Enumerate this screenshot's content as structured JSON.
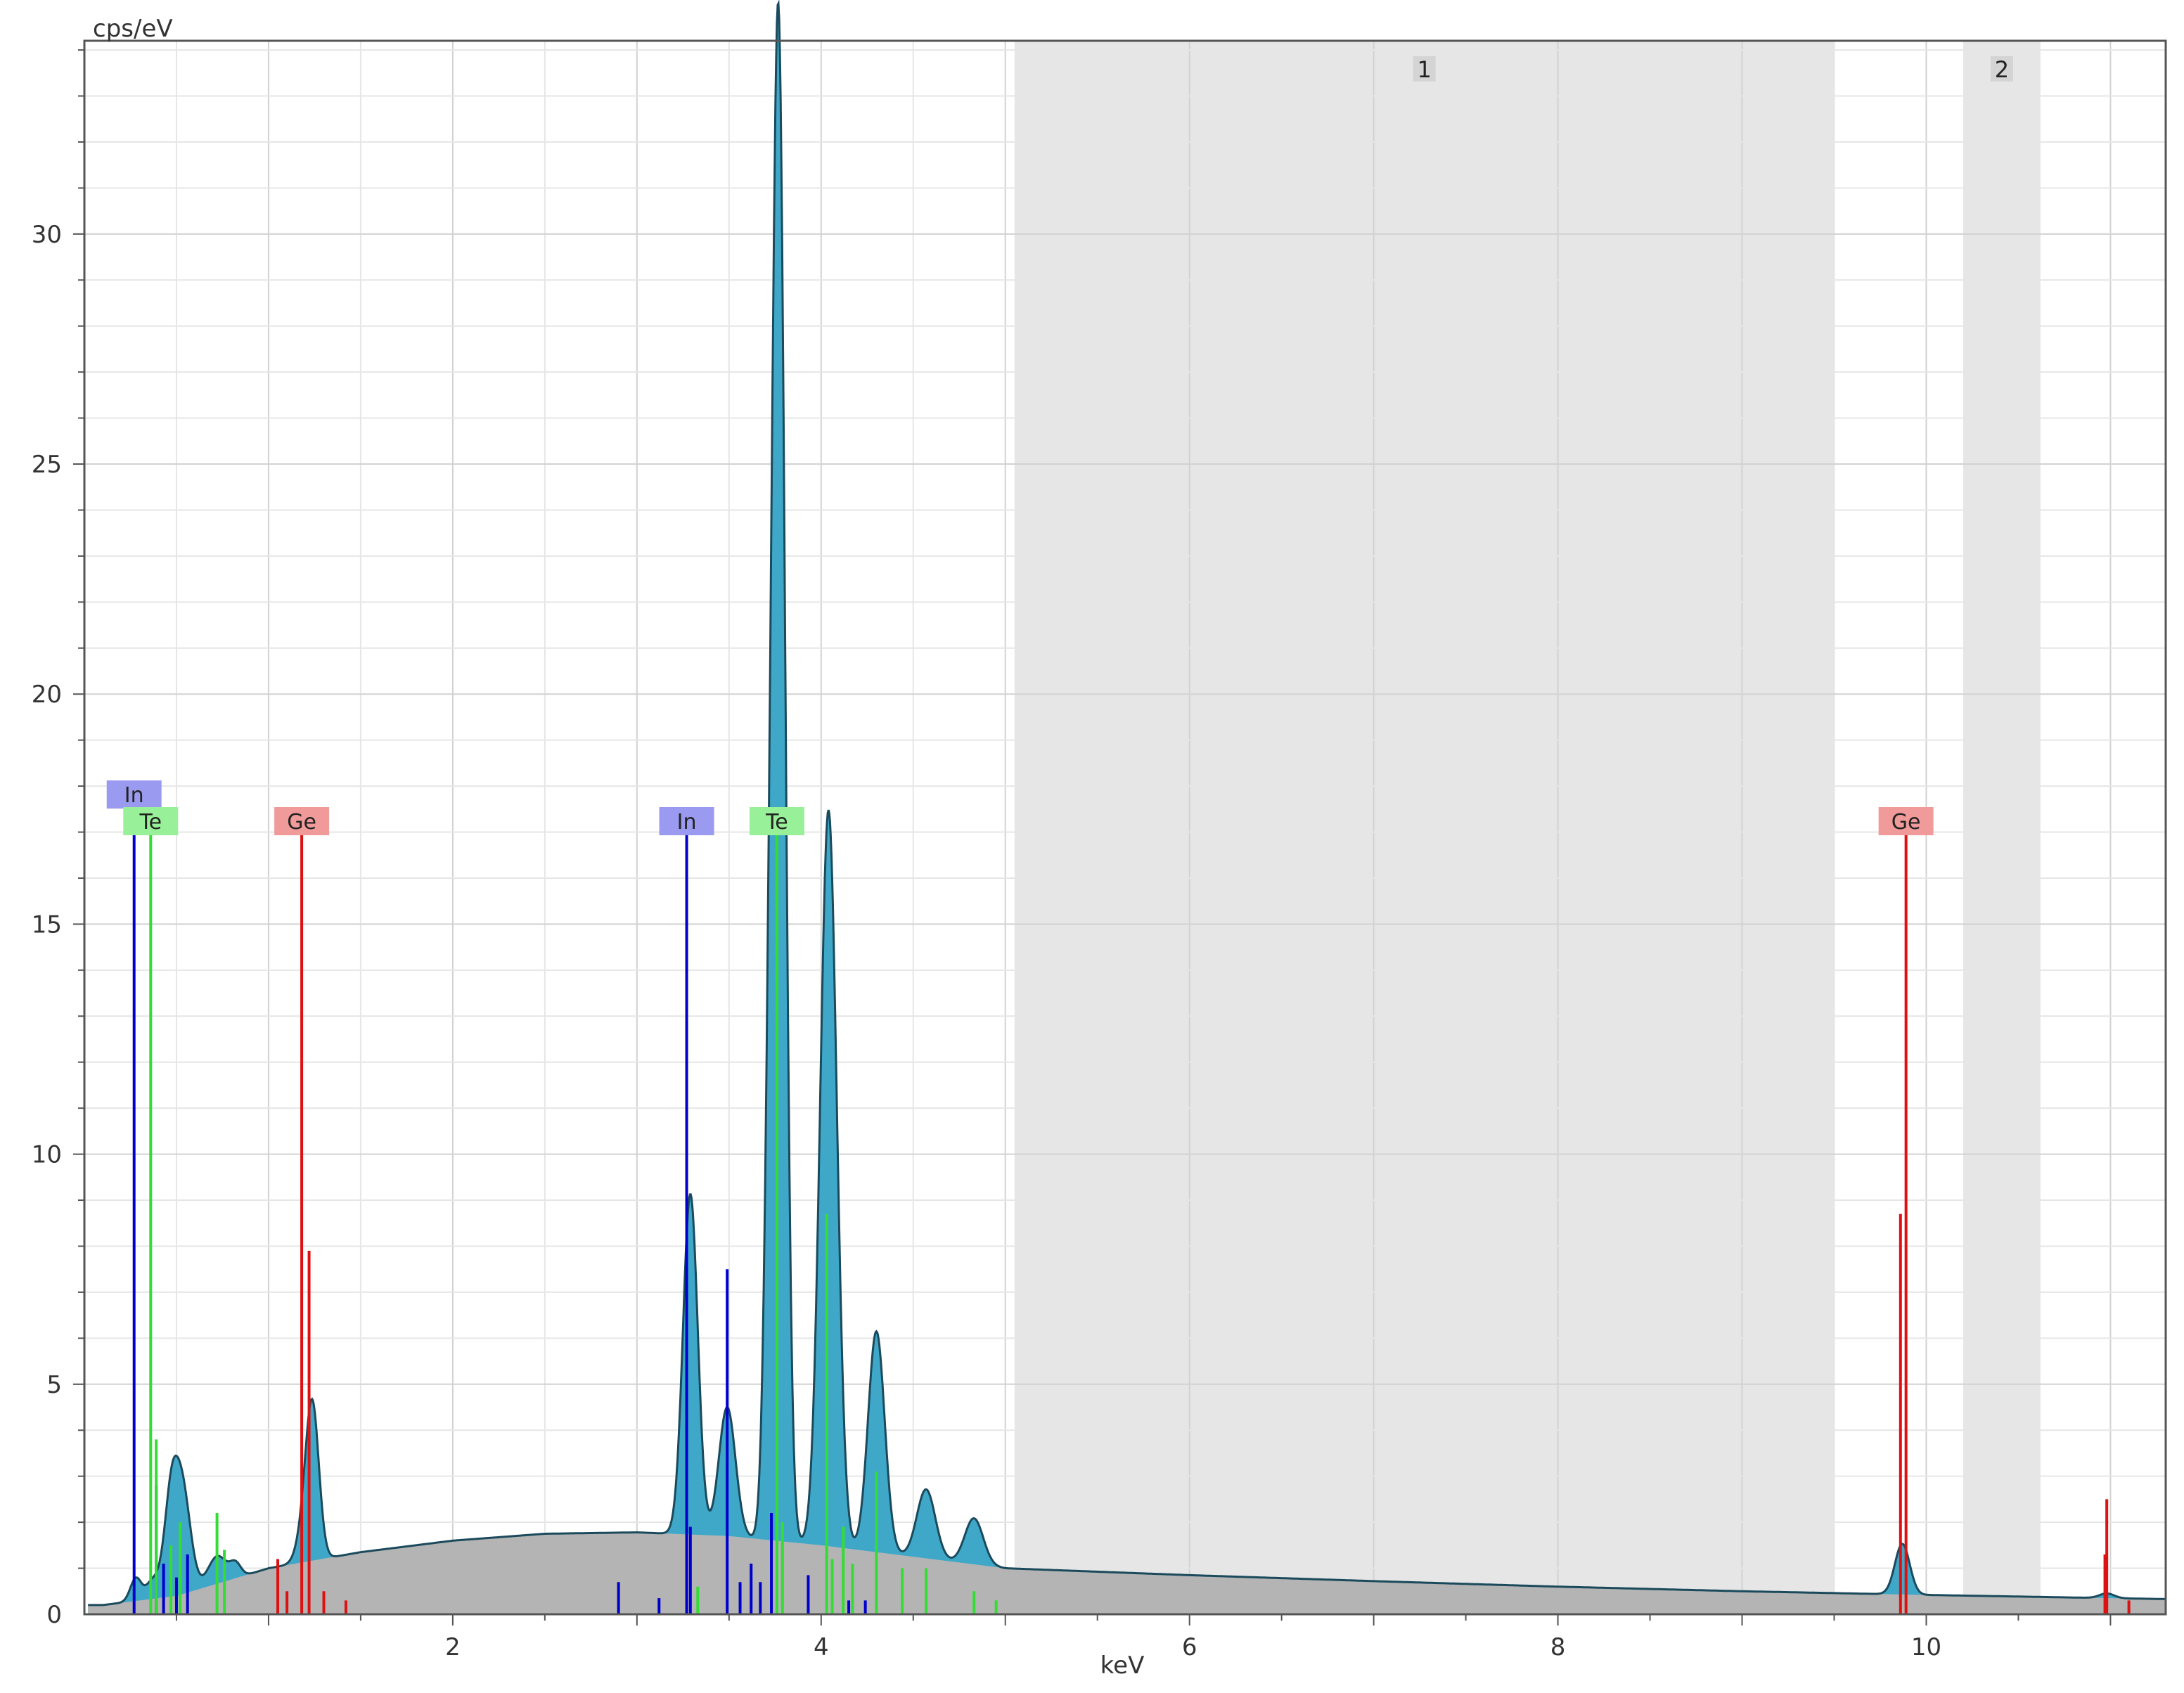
{
  "chart_data": {
    "type": "area",
    "ylabel": "cps/eV",
    "xlabel": "keV",
    "xlim": [
      0,
      11.3
    ],
    "ylim": [
      0,
      34.2
    ],
    "x_ticks": [
      2,
      4,
      6,
      8,
      10
    ],
    "x_tick_labels": [
      "2",
      "4",
      "6",
      "8",
      "10"
    ],
    "y_ticks": [
      5,
      10,
      15,
      20,
      25,
      30
    ],
    "y_tick_labels": [
      "5",
      "10",
      "15",
      "20",
      "25",
      "30"
    ],
    "grid": true,
    "regions": [
      {
        "label": "1",
        "x_range": [
          5.05,
          9.5
        ]
      },
      {
        "label": "2",
        "x_range": [
          10.2,
          10.62
        ]
      }
    ],
    "colors": {
      "spectrum_fill": "#3fa8c9",
      "spectrum_outline": "#1b4a5c",
      "background_fill": "#b4b4b4",
      "region_fill": "#e6e6e6",
      "In": "#0000cc",
      "Te": "#33dd33",
      "Ge": "#dd1111",
      "In_label_bg": "#9a9af0",
      "Te_label_bg": "#98f098",
      "Ge_label_bg": "#f09a9a"
    },
    "spectrum": {
      "background": [
        [
          0.1,
          0.2
        ],
        [
          0.5,
          0.4
        ],
        [
          1.0,
          1.0
        ],
        [
          1.5,
          1.35
        ],
        [
          2.0,
          1.6
        ],
        [
          2.5,
          1.75
        ],
        [
          3.0,
          1.78
        ],
        [
          3.5,
          1.7
        ],
        [
          4.0,
          1.5
        ],
        [
          4.5,
          1.25
        ],
        [
          5.0,
          1.0
        ],
        [
          6.0,
          0.85
        ],
        [
          7.0,
          0.72
        ],
        [
          8.0,
          0.6
        ],
        [
          9.0,
          0.5
        ],
        [
          10.0,
          0.42
        ],
        [
          11.0,
          0.35
        ],
        [
          11.3,
          0.33
        ]
      ],
      "peaks": [
        {
          "x": 0.28,
          "h": 0.5,
          "w": 0.03
        },
        {
          "x": 0.36,
          "h": 0.25,
          "w": 0.03
        },
        {
          "x": 0.41,
          "h": 0.3,
          "w": 0.04
        },
        {
          "x": 0.47,
          "h": 1.7,
          "w": 0.035
        },
        {
          "x": 0.53,
          "h": 2.3,
          "w": 0.045
        },
        {
          "x": 0.72,
          "h": 0.6,
          "w": 0.05
        },
        {
          "x": 0.82,
          "h": 0.3,
          "w": 0.03
        },
        {
          "x": 1.2,
          "h": 0.8,
          "w": 0.04
        },
        {
          "x": 1.24,
          "h": 3.0,
          "w": 0.035
        },
        {
          "x": 3.29,
          "h": 7.4,
          "w": 0.04
        },
        {
          "x": 3.49,
          "h": 2.8,
          "w": 0.045
        },
        {
          "x": 3.72,
          "h": 6.0,
          "w": 0.03
        },
        {
          "x": 3.77,
          "h": 31.8,
          "w": 0.035
        },
        {
          "x": 4.04,
          "h": 16.0,
          "w": 0.045
        },
        {
          "x": 4.3,
          "h": 4.8,
          "w": 0.045
        },
        {
          "x": 4.57,
          "h": 1.5,
          "w": 0.05
        },
        {
          "x": 4.83,
          "h": 1.0,
          "w": 0.05
        },
        {
          "x": 9.87,
          "h": 1.1,
          "w": 0.04
        },
        {
          "x": 10.98,
          "h": 0.1,
          "w": 0.04
        }
      ]
    },
    "elements": [
      {
        "symbol": "In",
        "label_x": 0.27,
        "label_row": 0,
        "lines": [
          {
            "x": 0.27,
            "h": 17.1
          },
          {
            "x": 0.39,
            "h": 2.8
          },
          {
            "x": 0.43,
            "h": 1.1
          },
          {
            "x": 0.5,
            "h": 0.8
          },
          {
            "x": 0.56,
            "h": 1.3
          },
          {
            "x": 2.9,
            "h": 0.7
          },
          {
            "x": 3.12,
            "h": 0.35
          },
          {
            "x": 3.27,
            "h": 17.1
          },
          {
            "x": 3.29,
            "h": 1.9
          },
          {
            "x": 3.49,
            "h": 7.5
          },
          {
            "x": 3.56,
            "h": 0.7
          },
          {
            "x": 3.62,
            "h": 1.1
          },
          {
            "x": 3.67,
            "h": 0.7
          },
          {
            "x": 3.73,
            "h": 2.2
          },
          {
            "x": 3.93,
            "h": 0.85
          },
          {
            "x": 4.15,
            "h": 0.3
          },
          {
            "x": 4.24,
            "h": 0.3
          }
        ]
      },
      {
        "symbol": "Te",
        "label_x": 0.36,
        "label_row": 1,
        "lines": [
          {
            "x": 0.36,
            "h": 17.1
          },
          {
            "x": 0.39,
            "h": 3.8
          },
          {
            "x": 0.47,
            "h": 1.5
          },
          {
            "x": 0.52,
            "h": 2.0
          },
          {
            "x": 0.72,
            "h": 2.2
          },
          {
            "x": 0.76,
            "h": 1.4
          },
          {
            "x": 3.33,
            "h": 0.6
          },
          {
            "x": 3.76,
            "h": 17.1
          },
          {
            "x": 3.79,
            "h": 2.0
          },
          {
            "x": 4.03,
            "h": 8.7
          },
          {
            "x": 4.06,
            "h": 1.2
          },
          {
            "x": 4.12,
            "h": 1.9
          },
          {
            "x": 4.17,
            "h": 1.1
          },
          {
            "x": 4.3,
            "h": 3.1
          },
          {
            "x": 4.44,
            "h": 1.0
          },
          {
            "x": 4.57,
            "h": 1.0
          },
          {
            "x": 4.83,
            "h": 0.5
          },
          {
            "x": 4.95,
            "h": 0.3
          }
        ]
      },
      {
        "symbol": "Ge",
        "label_x": 1.18,
        "label_row": 1,
        "lines": [
          {
            "x": 1.18,
            "h": 17.1
          },
          {
            "x": 1.05,
            "h": 1.2
          },
          {
            "x": 1.1,
            "h": 0.5
          },
          {
            "x": 1.22,
            "h": 7.9
          },
          {
            "x": 1.3,
            "h": 0.5
          },
          {
            "x": 1.42,
            "h": 0.3
          },
          {
            "x": 9.86,
            "h": 8.7
          },
          {
            "x": 9.89,
            "h": 17.1
          },
          {
            "x": 10.97,
            "h": 1.3
          },
          {
            "x": 10.98,
            "h": 2.5
          },
          {
            "x": 11.1,
            "h": 0.3
          }
        ]
      }
    ],
    "marker_labels": [
      {
        "symbol": "In",
        "x": 0.27,
        "row": 0
      },
      {
        "symbol": "Te",
        "x": 0.36,
        "row": 1
      },
      {
        "symbol": "Ge",
        "x": 1.18,
        "row": 1
      },
      {
        "symbol": "In",
        "x": 3.27,
        "row": 1
      },
      {
        "symbol": "Te",
        "x": 3.76,
        "row": 1
      },
      {
        "symbol": "Ge",
        "x": 9.89,
        "row": 1
      }
    ]
  }
}
